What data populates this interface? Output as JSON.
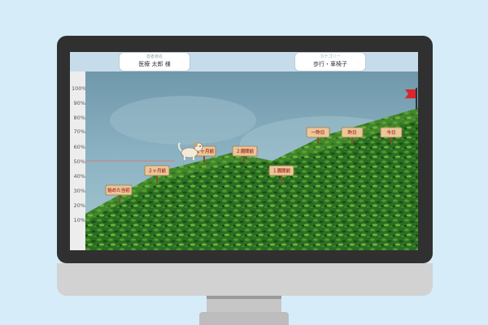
{
  "header": {
    "user_label": "患者様名",
    "user_value": "医療 太郎 様",
    "category_label": "カテゴリー",
    "category_value": "歩行・車椅子"
  },
  "axis": {
    "ticks": [
      "100%",
      "90%",
      "80%",
      "70%",
      "60%",
      "50%",
      "40%",
      "30%",
      "20%",
      "10%"
    ],
    "highlight_level": "50%"
  },
  "progress": {
    "current_percent": 50,
    "milestones": [
      {
        "label": "始めた当初",
        "percent": 29
      },
      {
        "label": "２ヶ月前",
        "percent": 40
      },
      {
        "label": "１ヶ月前",
        "percent": 52
      },
      {
        "label": "２週間前",
        "percent": 52
      },
      {
        "label": "１週間前",
        "percent": 40
      },
      {
        "label": "一昨日",
        "percent": 74
      },
      {
        "label": "昨日",
        "percent": 74
      },
      {
        "label": "今日",
        "percent": 74
      }
    ],
    "goal_flag_color": "#d8272e",
    "indicator_line_color": "#c28b8b"
  },
  "colors": {
    "sky": "#7fa6b8",
    "hill_dark": "#1f5a1b",
    "hill_light": "#4fa32f"
  }
}
